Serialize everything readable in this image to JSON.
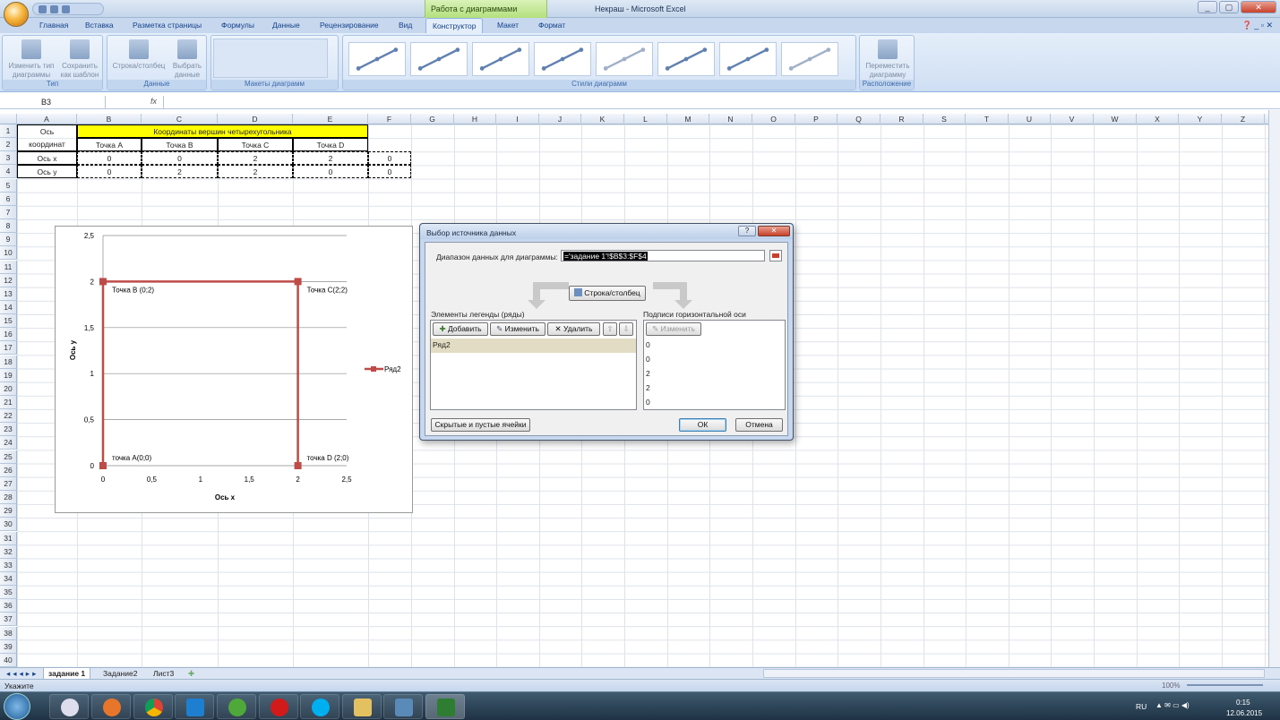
{
  "window": {
    "context_tab_title": "Работа с диаграммами",
    "app_title": "Некраш - Microsoft Excel",
    "controls": [
      "_",
      "▢",
      "✕"
    ]
  },
  "ribbon": {
    "tabs": [
      "Главная",
      "Вставка",
      "Разметка страницы",
      "Формулы",
      "Данные",
      "Рецензирование",
      "Вид",
      "Конструктор",
      "Макет",
      "Формат"
    ],
    "active_tab": "Конструктор",
    "right_controls": "❓ _ ▫ ✕",
    "groups": {
      "type": {
        "label": "Тип",
        "btn1": "Изменить тип диаграммы",
        "btn2": "Сохранить как шаблон"
      },
      "data": {
        "label": "Данные",
        "btn1": "Строка/столбец",
        "btn2": "Выбрать данные"
      },
      "layouts": {
        "label": "Макеты диаграмм"
      },
      "styles": {
        "label": "Стили диаграмм"
      },
      "location": {
        "label": "Расположение",
        "btn1": "Переместить диаграмму"
      }
    }
  },
  "formula_bar": {
    "name_box": "B3",
    "fx": "fx",
    "value": ""
  },
  "sheet": {
    "columns": [
      "A",
      "B",
      "C",
      "D",
      "E",
      "F",
      "G",
      "H",
      "I",
      "J",
      "K",
      "L",
      "M",
      "N",
      "O",
      "P",
      "Q",
      "R",
      "S",
      "T",
      "U",
      "V",
      "W",
      "X",
      "Y",
      "Z"
    ],
    "rows": [
      "1",
      "2",
      "3",
      "4",
      "5",
      "6",
      "7",
      "8",
      "9",
      "10",
      "11",
      "12",
      "13",
      "14",
      "15",
      "16",
      "17",
      "18",
      "19",
      "20",
      "21",
      "22",
      "23",
      "24",
      "25",
      "26",
      "27",
      "28",
      "29",
      "30",
      "31",
      "32",
      "33",
      "34",
      "35",
      "36",
      "37",
      "38",
      "39",
      "40",
      "41"
    ],
    "a1": "Ось",
    "a2": "координат",
    "header_merged": "Координаты вершин четырехугольника",
    "point_headers": [
      "Точка А",
      "Точка В",
      "Точка С",
      "Точка D"
    ],
    "row3": {
      "label": "Ось х",
      "values": [
        "0",
        "0",
        "2",
        "2",
        "0"
      ]
    },
    "row4": {
      "label": "Ось у",
      "values": [
        "0",
        "2",
        "2",
        "0",
        "0"
      ]
    }
  },
  "chart_data": {
    "type": "scatter",
    "x": [
      0,
      0,
      2,
      2
    ],
    "y": [
      0,
      2,
      2,
      0
    ],
    "series": [
      {
        "name": "Ряд2",
        "x": [
          0,
          0,
          2,
          2
        ],
        "y": [
          0,
          2,
          2,
          0
        ],
        "color": "#be4b48"
      }
    ],
    "point_labels": [
      "точка А(0;0)",
      "Точка В (0;2)",
      "Точка С(2;2)",
      "точка D (2;0)"
    ],
    "xlabel": "Ось x",
    "ylabel": "Ось y",
    "xlim": [
      0,
      2.5
    ],
    "ylim": [
      0,
      2.5
    ],
    "x_ticks": [
      "0",
      "0,5",
      "1",
      "1,5",
      "2",
      "2,5"
    ],
    "y_ticks": [
      "0",
      "0,5",
      "1",
      "1,5",
      "2",
      "2,5"
    ],
    "grid": true,
    "legend": "right"
  },
  "dialog": {
    "title": "Выбор источника данных",
    "help": "?",
    "close": "✕",
    "range_label": "Диапазон данных для диаграммы:",
    "range_value": "='задание 1'!$B$3:$F$4",
    "switch_button": "Строка/столбец",
    "legend_label": "Элементы легенды (ряды)",
    "add": "Добавить",
    "edit": "Изменить",
    "delete": "Удалить",
    "series_items": [
      "Ряд2"
    ],
    "axis_label": "Подписи горизонтальной оси (категории)",
    "axis_edit": "Изменить",
    "axis_items": [
      "0",
      "0",
      "2",
      "2",
      "0"
    ],
    "hidden_cells": "Скрытые и пустые ячейки",
    "ok": "ОК",
    "cancel": "Отмена"
  },
  "sheet_tabs": [
    "задание 1",
    "Задание2",
    "Лист3"
  ],
  "status": {
    "text": "Укажите",
    "zoom": "100%"
  },
  "taskbar": {
    "lang": "RU",
    "time": "0:15",
    "date": "12.06.2015"
  }
}
